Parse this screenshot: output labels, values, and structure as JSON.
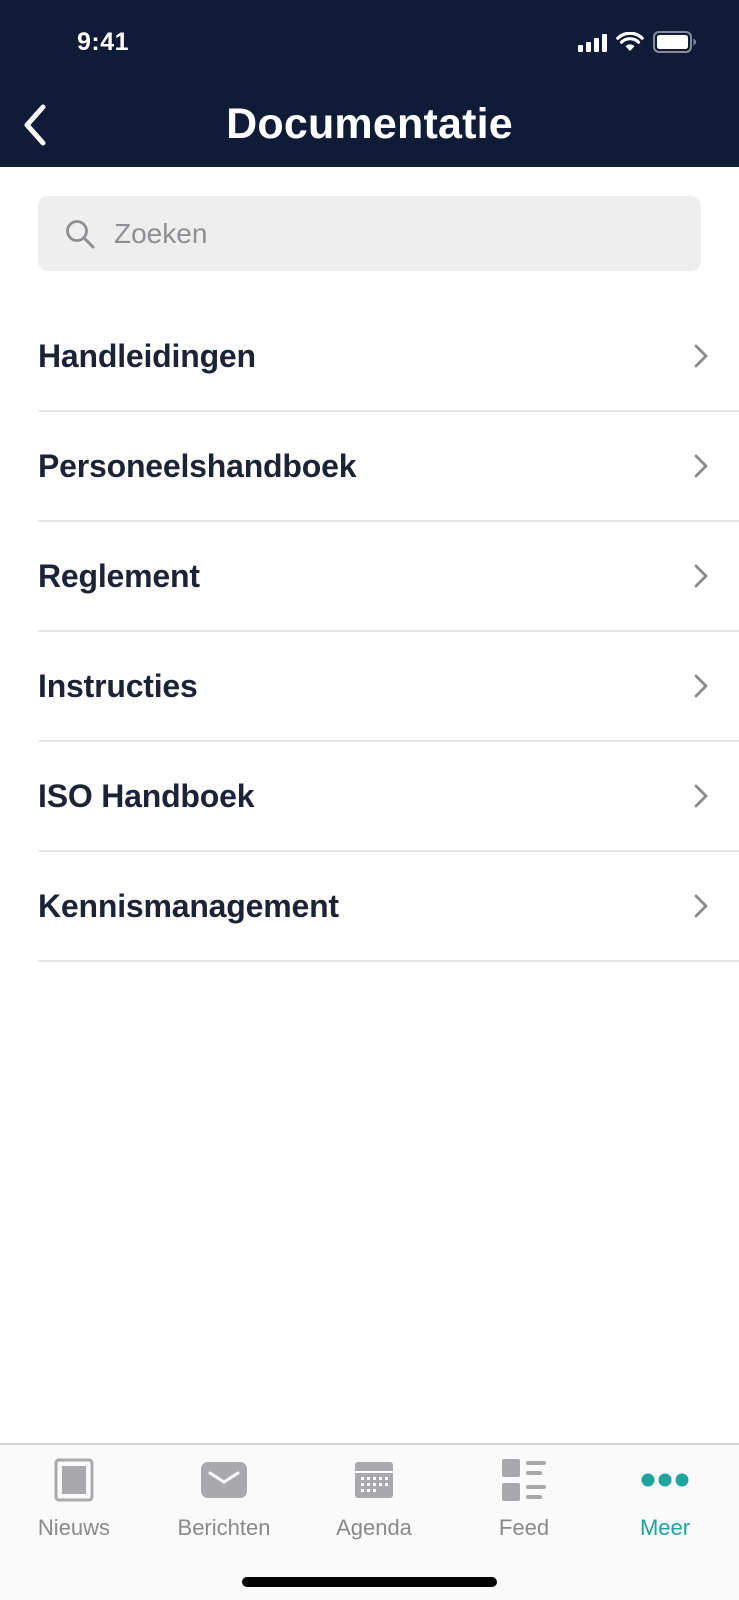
{
  "status_bar": {
    "time": "9:41"
  },
  "header": {
    "title": "Documentatie"
  },
  "search": {
    "placeholder": "Zoeken",
    "value": ""
  },
  "list": {
    "items": [
      {
        "label": "Handleidingen"
      },
      {
        "label": "Personeelshandboek"
      },
      {
        "label": "Reglement"
      },
      {
        "label": "Instructies"
      },
      {
        "label": "ISO Handboek"
      },
      {
        "label": "Kennismanagement"
      }
    ]
  },
  "tabbar": {
    "tabs": [
      {
        "label": "Nieuws",
        "icon": "newspaper-icon",
        "active": false
      },
      {
        "label": "Berichten",
        "icon": "envelope-icon",
        "active": false
      },
      {
        "label": "Agenda",
        "icon": "calendar-icon",
        "active": false
      },
      {
        "label": "Feed",
        "icon": "feed-icon",
        "active": false
      },
      {
        "label": "Meer",
        "icon": "more-dots-icon",
        "active": true
      }
    ]
  },
  "colors": {
    "header_bg": "#0f1b37",
    "accent": "#1ea39f",
    "text_dark": "#1d2336",
    "tab_inactive": "#8a8a8e"
  }
}
